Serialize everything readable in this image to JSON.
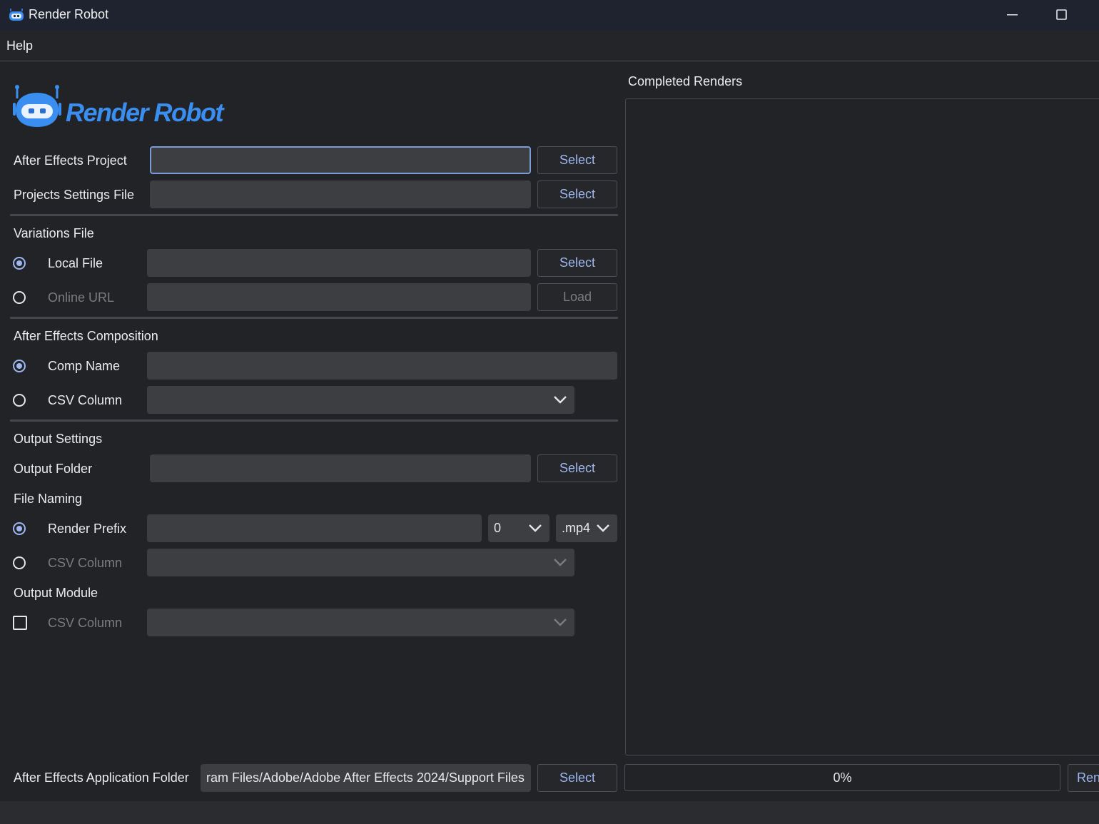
{
  "window": {
    "title": "Render Robot"
  },
  "menu": {
    "help": "Help"
  },
  "logo": {
    "text": "Render Robot",
    "color": "#3a8ef0"
  },
  "form": {
    "ae_project": {
      "label": "After Effects Project",
      "value": "",
      "button": "Select"
    },
    "project_settings": {
      "label": "Projects Settings File",
      "value": "",
      "button": "Select"
    },
    "variations": {
      "heading": "Variations File",
      "local_file": {
        "label": "Local File",
        "value": "",
        "button": "Select",
        "checked": true
      },
      "online_url": {
        "label": "Online URL",
        "value": "",
        "button": "Load",
        "checked": false
      }
    },
    "composition": {
      "heading": "After Effects Composition",
      "comp_name": {
        "label": "Comp Name",
        "value": "",
        "checked": true
      },
      "csv_column": {
        "label": "CSV Column",
        "value": "",
        "checked": false
      }
    },
    "output": {
      "heading": "Output Settings",
      "folder": {
        "label": "Output Folder",
        "value": "",
        "button": "Select"
      },
      "file_naming": {
        "heading": "File Naming",
        "render_prefix": {
          "label": "Render Prefix",
          "value": "",
          "padding": "0",
          "extension": ".mp4",
          "checked": true
        },
        "csv_column": {
          "label": "CSV Column",
          "value": "",
          "checked": false
        }
      },
      "module": {
        "heading": "Output Module",
        "csv_column": {
          "label": "CSV Column",
          "value": "",
          "checked": false
        }
      }
    },
    "app_folder": {
      "label": "After Effects Application Folder",
      "value": "ram Files/Adobe/Adobe After Effects 2024/Support Files",
      "button": "Select"
    }
  },
  "completed": {
    "heading": "Completed Renders"
  },
  "progress": {
    "text": "0%",
    "value": 0
  },
  "render_button": {
    "label": "Ren"
  },
  "colors": {
    "accent": "#9db6ef",
    "background": "#222327",
    "field": "#3d3e42"
  }
}
